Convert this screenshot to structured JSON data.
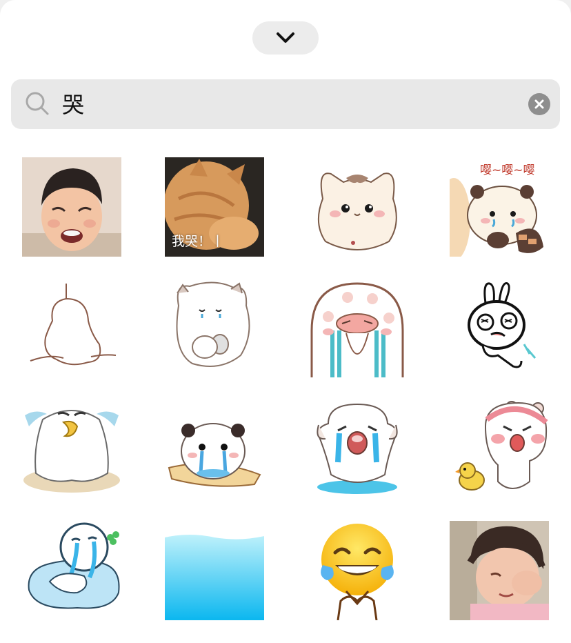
{
  "search": {
    "query": "哭",
    "placeholder": "",
    "icon": "search-icon",
    "clear_icon": "clear-icon"
  },
  "header": {
    "collapse_icon": "chevron-down-icon"
  },
  "colors": {
    "sheet_background": "#ffffff",
    "search_background": "#e8e8e8",
    "collapse_background": "#ececec",
    "clear_button": "#8e8e8e"
  },
  "stickers": [
    {
      "name": "crying-boy-photo"
    },
    {
      "name": "sad-cat-photo",
      "caption": "我哭！丨"
    },
    {
      "name": "cream-cat-sticker"
    },
    {
      "name": "panda-raccoon-sticker",
      "text": "嘤~嘤~嘤"
    },
    {
      "name": "outline-blob-sticker"
    },
    {
      "name": "white-hamster-sticker"
    },
    {
      "name": "crying-mushroom-sticker"
    },
    {
      "name": "crying-bunny-sticker"
    },
    {
      "name": "crying-duck-ghost-sticker"
    },
    {
      "name": "crying-panda-sticker"
    },
    {
      "name": "crying-puppy-puddle-sticker"
    },
    {
      "name": "crying-bear-duckling-sticker"
    },
    {
      "name": "crying-blob-puddle-sticker"
    },
    {
      "name": "blue-water-sticker"
    },
    {
      "name": "tears-of-joy-emoji-sticker"
    },
    {
      "name": "crying-baby-photo"
    }
  ]
}
